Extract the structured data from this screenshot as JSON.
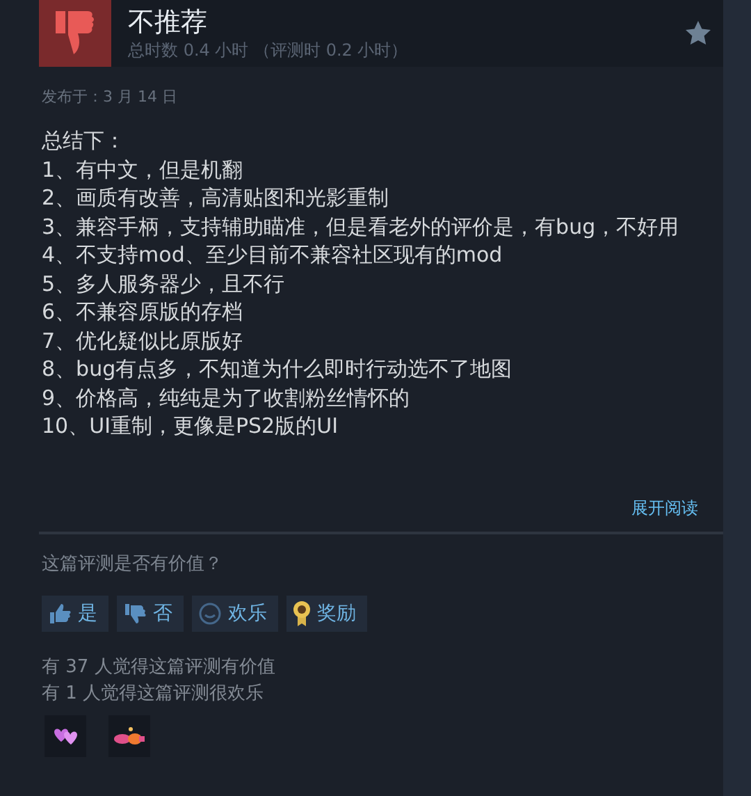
{
  "review": {
    "verdict": "不推荐",
    "hours": "总时数 0.4 小时 （评测时 0.2 小时）",
    "posted": "发布于：3 月 14 日",
    "lines": [
      "总结下：",
      "1、有中文，但是机翻",
      "2、画质有改善，高清贴图和光影重制",
      "3、兼容手柄，支持辅助瞄准，但是看老外的评价是，有bug，不好用",
      "4、不支持mod、至少目前不兼容社区现有的mod",
      "5、多人服务器少，且不行",
      "6、不兼容原版的存档",
      "7、优化疑似比原版好",
      "8、bug有点多，不知道为什么即时行动选不了地图",
      "9、价格高，纯纯是为了收割粉丝情怀的",
      "10、UI重制，更像是PS2版的UI"
    ],
    "expand": "展开阅读"
  },
  "feedback": {
    "question": "这篇评测是否有价值？",
    "buttons": [
      {
        "kind": "yes",
        "label": "是"
      },
      {
        "kind": "no",
        "label": "否"
      },
      {
        "kind": "funny",
        "label": "欢乐"
      },
      {
        "kind": "award",
        "label": "奖励"
      }
    ],
    "stats": [
      "有 37 人觉得这篇评测有价值",
      "有 1 人觉得这篇评测很欢乐"
    ],
    "awards": [
      {
        "kind": "heart"
      },
      {
        "kind": "party"
      }
    ]
  }
}
